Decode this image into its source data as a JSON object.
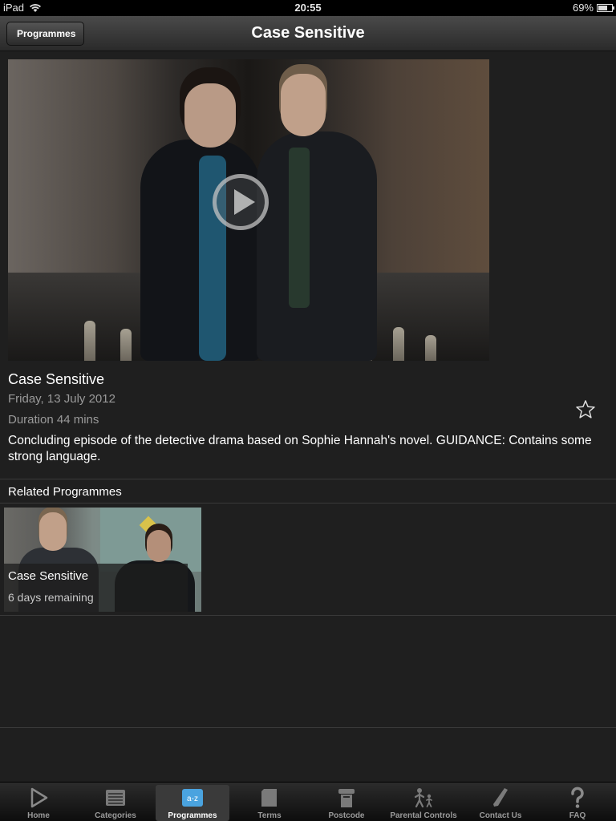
{
  "status_bar": {
    "device": "iPad",
    "time": "20:55",
    "battery": "69%",
    "battery_level": 0.69
  },
  "nav": {
    "back_label": "Programmes",
    "title": "Case Sensitive"
  },
  "programme": {
    "title": "Case Sensitive",
    "date": "Friday, 13 July 2012",
    "duration": "Duration 44 mins",
    "description": "Concluding episode of the detective drama based on Sophie Hannah's novel. GUIDANCE: Contains some strong language.",
    "favourite_icon": "star-outline-icon",
    "play_icon": "play-icon"
  },
  "related": {
    "heading": "Related Programmes",
    "items": [
      {
        "title": "Case Sensitive",
        "subtitle": "6 days remaining"
      }
    ]
  },
  "tabs": [
    {
      "label": "Home",
      "icon": "play-icon"
    },
    {
      "label": "Categories",
      "icon": "list-icon"
    },
    {
      "label": "Programmes",
      "icon": "a-z-icon",
      "icon_text": "a-z",
      "active": true
    },
    {
      "label": "Terms",
      "icon": "document-icon"
    },
    {
      "label": "Postcode",
      "icon": "postbox-icon"
    },
    {
      "label": "Parental Controls",
      "icon": "parent-child-icon"
    },
    {
      "label": "Contact Us",
      "icon": "phone-icon"
    },
    {
      "label": "FAQ",
      "icon": "question-icon"
    }
  ],
  "colors": {
    "background": "#1f1f1f",
    "active_tab_icon": "#4aa3df",
    "muted_text": "#9a9a9a"
  }
}
